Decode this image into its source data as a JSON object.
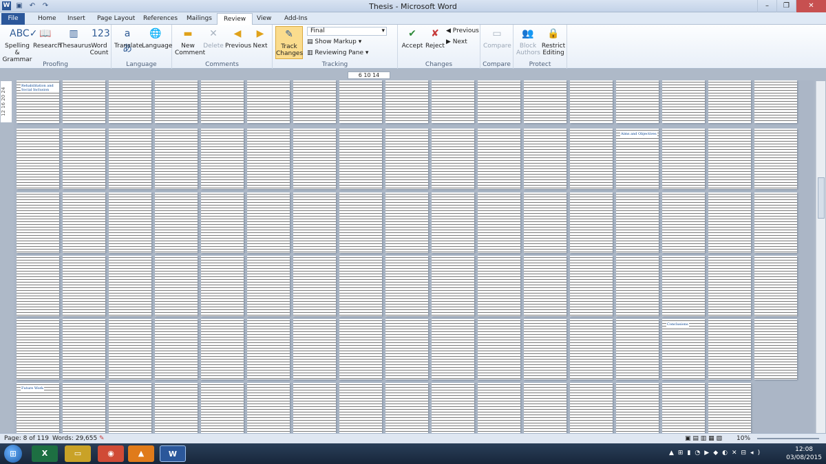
{
  "window": {
    "title": "Thesis - Microsoft Word"
  },
  "tabs": [
    "File",
    "Home",
    "Insert",
    "Page Layout",
    "References",
    "Mailings",
    "Review",
    "View",
    "Add-Ins"
  ],
  "ribbon": {
    "proofing": {
      "label": "Proofing",
      "spelling": "Spelling &",
      "grammar": "Grammar",
      "research": "Research",
      "thesaurus": "Thesaurus",
      "word": "Word",
      "count": "Count"
    },
    "language": {
      "label": "Language",
      "translate": "Translate",
      "language": "Language"
    },
    "comments": {
      "label": "Comments",
      "new": "New",
      "comment": "Comment",
      "delete": "Delete",
      "previous": "Previous",
      "next": "Next"
    },
    "tracking": {
      "label": "Tracking",
      "track": "Track",
      "changes": "Changes",
      "final": "Final",
      "show_markup": "Show Markup",
      "reviewing_pane": "Reviewing Pane"
    },
    "changes": {
      "label": "Changes",
      "accept": "Accept",
      "reject": "Reject",
      "previous": "Previous",
      "next": "Next"
    },
    "compare": {
      "label": "Compare",
      "compare": "Compare"
    },
    "protect": {
      "label": "Protect",
      "block": "Block",
      "authors": "Authors",
      "restrict": "Restrict",
      "editing": "Editing"
    }
  },
  "ruler": {
    "h": "6  10  14",
    "v": "12  16  20  24"
  },
  "status": {
    "page": "Page: 8 of 119",
    "words": "Words: 29,655",
    "zoom": "10%"
  },
  "clock": {
    "time": "12:08",
    "date": "03/08/2015"
  },
  "page_labels": [
    "Rehabilitation and Social Inclusion",
    "Aims and Objectives",
    "Conclusions",
    "Future Work"
  ],
  "icons": [
    "spelling-check-icon",
    "research-book-icon",
    "thesaurus-book-icon",
    "word-count-icon",
    "translate-icon",
    "language-globe-icon",
    "new-comment-icon",
    "delete-comment-icon",
    "previous-comment-icon",
    "next-comment-icon",
    "track-changes-icon",
    "accept-icon",
    "reject-icon",
    "compare-icon",
    "block-authors-icon",
    "restrict-editing-icon"
  ]
}
